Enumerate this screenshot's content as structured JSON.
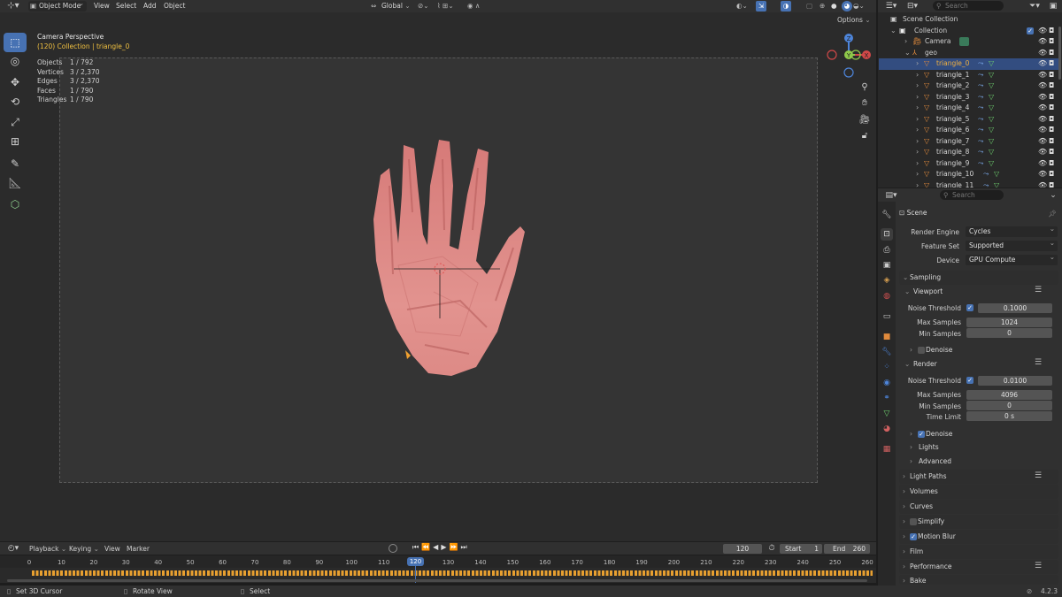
{
  "topbar": {
    "mode": "Object Mode",
    "menus": [
      "View",
      "Select",
      "Add",
      "Object"
    ],
    "orientation": "Global",
    "options": "Options"
  },
  "viewport": {
    "title": "Camera Perspective",
    "subtitle": "(120) Collection | triangle_0",
    "stats": [
      {
        "label": "Objects",
        "value": "1 / 792"
      },
      {
        "label": "Vertices",
        "value": "3 / 2,370"
      },
      {
        "label": "Edges",
        "value": "3 / 2,370"
      },
      {
        "label": "Faces",
        "value": "1 / 790"
      },
      {
        "label": "Triangles",
        "value": "1 / 790"
      }
    ],
    "gizmo": {
      "x": "X",
      "y": "Y",
      "z": "Z"
    },
    "colors": {
      "background": "#2b2b2b",
      "camera_frame": "#333333",
      "hand": "#d97f7c",
      "accent": "#4772b3"
    }
  },
  "outliner": {
    "search_placeholder": "Search",
    "scene_collection": "Scene Collection",
    "collection": "Collection",
    "camera": "Camera",
    "geo": "geo",
    "items": [
      "triangle_0",
      "triangle_1",
      "triangle_2",
      "triangle_3",
      "triangle_4",
      "triangle_5",
      "triangle_6",
      "triangle_7",
      "triangle_8",
      "triangle_9",
      "triangle_10",
      "triangle_11"
    ],
    "selected": "triangle_0"
  },
  "properties": {
    "search_placeholder": "Search",
    "context": "Scene",
    "render_engine_label": "Render Engine",
    "render_engine": "Cycles",
    "feature_set_label": "Feature Set",
    "feature_set": "Supported",
    "device_label": "Device",
    "device": "GPU Compute",
    "sampling": "Sampling",
    "viewport": {
      "title": "Viewport",
      "noise_threshold_label": "Noise Threshold",
      "noise_threshold": "0.1000",
      "max_samples_label": "Max Samples",
      "max_samples": "1024",
      "min_samples_label": "Min Samples",
      "min_samples": "0",
      "denoise": "Denoise"
    },
    "render": {
      "title": "Render",
      "noise_threshold_label": "Noise Threshold",
      "noise_threshold": "0.0100",
      "max_samples_label": "Max Samples",
      "max_samples": "4096",
      "min_samples_label": "Min Samples",
      "min_samples": "0",
      "time_limit_label": "Time Limit",
      "time_limit": "0 s",
      "denoise": "Denoise",
      "lights": "Lights",
      "advanced": "Advanced"
    },
    "sections": [
      "Light Paths",
      "Volumes",
      "Curves",
      "Simplify",
      "Motion Blur",
      "Film",
      "Performance",
      "Bake"
    ]
  },
  "timeline": {
    "menus": [
      "Playback",
      "Keying",
      "View",
      "Marker"
    ],
    "current_frame": "120",
    "start_label": "Start",
    "start": "1",
    "end_label": "End",
    "end": "260",
    "ticks": [
      "0",
      "10",
      "20",
      "30",
      "40",
      "50",
      "60",
      "70",
      "80",
      "90",
      "100",
      "110",
      "120",
      "130",
      "140",
      "150",
      "160",
      "170",
      "180",
      "190",
      "200",
      "210",
      "220",
      "230",
      "240",
      "250",
      "260"
    ]
  },
  "statusbar": {
    "items": [
      "Set 3D Cursor",
      "Rotate View",
      "Select"
    ],
    "version": "4.2.3"
  }
}
